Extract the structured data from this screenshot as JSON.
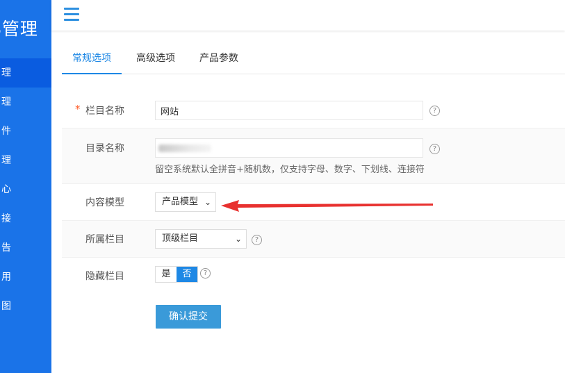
{
  "sidebar": {
    "brand": "S管理",
    "items": [
      {
        "label": "理"
      },
      {
        "label": "理"
      },
      {
        "label": "件"
      },
      {
        "label": "理"
      },
      {
        "label": "心"
      },
      {
        "label": "接"
      },
      {
        "label": "告"
      },
      {
        "label": "用"
      },
      {
        "label": "图"
      }
    ]
  },
  "tabs": [
    {
      "label": "常规选项"
    },
    {
      "label": "高级选项"
    },
    {
      "label": "产品参数"
    }
  ],
  "form": {
    "name": {
      "label": "栏目名称",
      "required": "*",
      "value": "网站"
    },
    "dir": {
      "label": "目录名称",
      "hint": "留空系统默认全拼音+随机数，仅支持字母、数字、下划线、连接符"
    },
    "model": {
      "label": "内容模型",
      "selected": "产品模型"
    },
    "parent": {
      "label": "所属栏目",
      "selected": "顶级栏目"
    },
    "hidden": {
      "label": "隐藏栏目",
      "yes": "是",
      "no": "否"
    },
    "submit": "确认提交"
  },
  "colors": {
    "sidebar": "#1a73e8",
    "accent": "#1e88e5",
    "arrow": "#e8312f"
  }
}
